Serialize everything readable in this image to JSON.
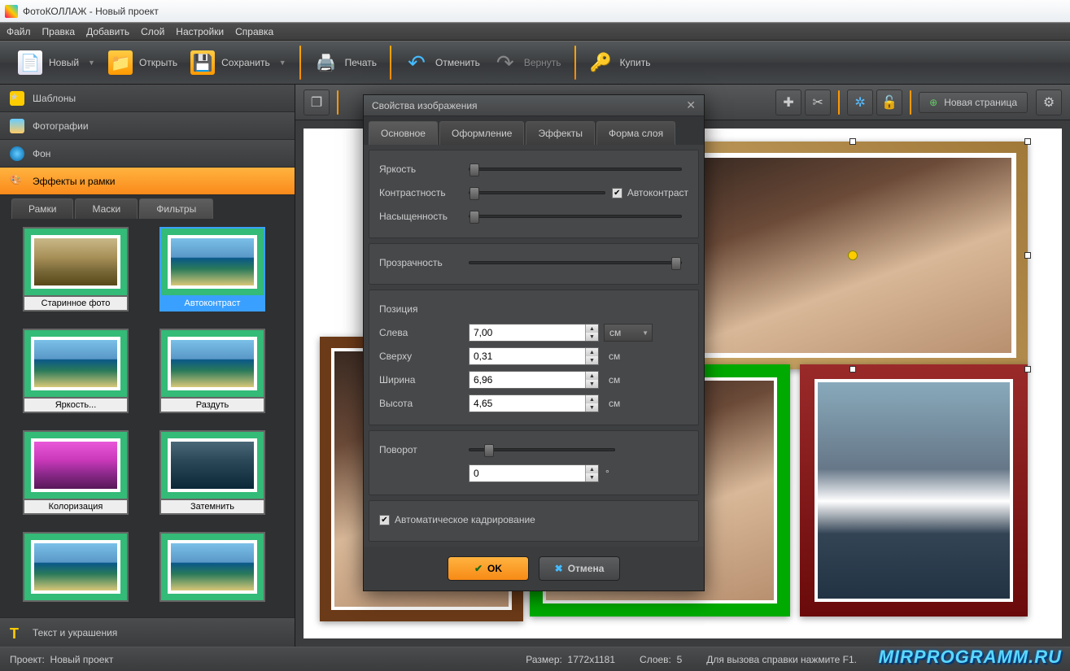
{
  "title": "ФотоКОЛЛАЖ - Новый проект",
  "menu": [
    "Файл",
    "Правка",
    "Добавить",
    "Слой",
    "Настройки",
    "Справка"
  ],
  "toolbar": {
    "new": "Новый",
    "open": "Открыть",
    "save": "Сохранить",
    "print": "Печать",
    "undo": "Отменить",
    "redo": "Вернуть",
    "buy": "Купить"
  },
  "sidebar": {
    "templates": "Шаблоны",
    "photos": "Фотографии",
    "background": "Фон",
    "effects": "Эффекты и рамки",
    "text": "Текст и украшения",
    "subtabs": {
      "frames": "Рамки",
      "masks": "Маски",
      "filters": "Фильтры"
    },
    "thumbs": [
      "Старинное фото",
      "Автоконтраст",
      "Яркость...",
      "Раздуть",
      "Колоризация",
      "Затемнить",
      "",
      ""
    ]
  },
  "canvasToolbar": {
    "newPage": "Новая страница"
  },
  "dialog": {
    "title": "Свойства изображения",
    "tabs": {
      "basic": "Основное",
      "style": "Оформление",
      "effects": "Эффекты",
      "shape": "Форма слоя"
    },
    "brightness": "Яркость",
    "contrast": "Контрастность",
    "saturation": "Насыщенность",
    "autocontrast": "Автоконтраст",
    "opacity": "Прозрачность",
    "position": "Позиция",
    "left": "Слева",
    "top": "Сверху",
    "width": "Ширина",
    "height": "Высота",
    "leftVal": "7,00",
    "topVal": "0,31",
    "widthVal": "6,96",
    "heightVal": "4,65",
    "unit": "см",
    "rotation": "Поворот",
    "rotationVal": "0",
    "deg": "°",
    "autocrop": "Автоматическое кадрирование",
    "ok": "OK",
    "cancel": "Отмена"
  },
  "status": {
    "project": "Проект:",
    "projectName": "Новый проект",
    "size": "Размер:",
    "sizeVal": "1772x1181",
    "layers": "Слоев:",
    "layersVal": "5",
    "help": "Для вызова справки нажмите F1."
  },
  "watermark": "MIRPROGRAMM.RU"
}
